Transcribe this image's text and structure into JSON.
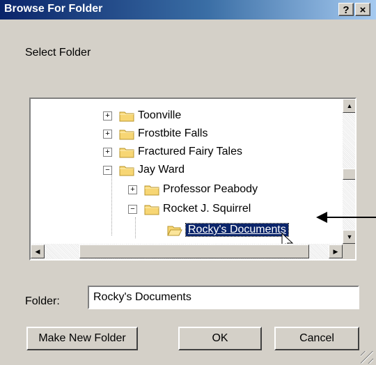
{
  "window": {
    "title": "Browse For Folder",
    "help_label": "?",
    "close_label": "×"
  },
  "prompt": "Select Folder",
  "tree": {
    "items": [
      {
        "label": "Toonville",
        "expander": "+"
      },
      {
        "label": "Frostbite Falls",
        "expander": "+"
      },
      {
        "label": "Fractured Fairy Tales",
        "expander": "+"
      },
      {
        "label": "Jay Ward",
        "expander": "−"
      },
      {
        "label": "Professor Peabody",
        "expander": "+"
      },
      {
        "label": "Rocket J. Squirrel",
        "expander": "−"
      },
      {
        "label": "Rocky's Documents",
        "selected": true
      }
    ]
  },
  "folder_field": {
    "label": "Folder:",
    "value": "Rocky's Documents"
  },
  "buttons": {
    "make_new_folder": "Make New Folder",
    "ok": "OK",
    "cancel": "Cancel"
  },
  "colors": {
    "title_gradient_start": "#0a246a",
    "title_gradient_end": "#a6caf0",
    "dialog_face": "#d4d0c8",
    "selection": "#0a246a"
  }
}
